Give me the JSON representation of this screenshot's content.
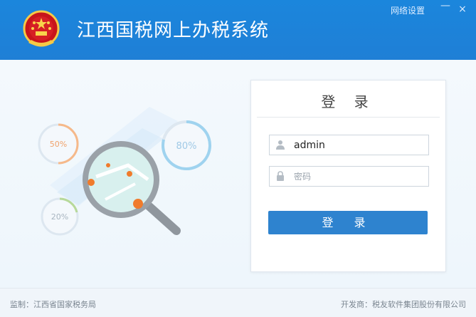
{
  "header": {
    "app_title": "江西国税网上办税系统",
    "network_settings_label": "网络设置",
    "minimize_glyph": "—",
    "close_glyph": "×"
  },
  "illustration": {
    "gauges": [
      {
        "percent": 50,
        "label": "50%"
      },
      {
        "percent": 80,
        "label": "80%"
      },
      {
        "percent": 20,
        "label": "20%"
      }
    ]
  },
  "login": {
    "title": "登 录",
    "username_value": "admin",
    "password_placeholder": "密码",
    "submit_label": "登 录"
  },
  "footer": {
    "supervisor": "监制：江西省国家税务局",
    "developer": "开发商：税友软件集团股份有限公司"
  },
  "colors": {
    "header_blue": "#1b86dc",
    "button_blue": "#2e83cf"
  },
  "icons": {
    "emblem": "national-emblem-icon",
    "username": "user-icon",
    "password": "lock-icon"
  }
}
